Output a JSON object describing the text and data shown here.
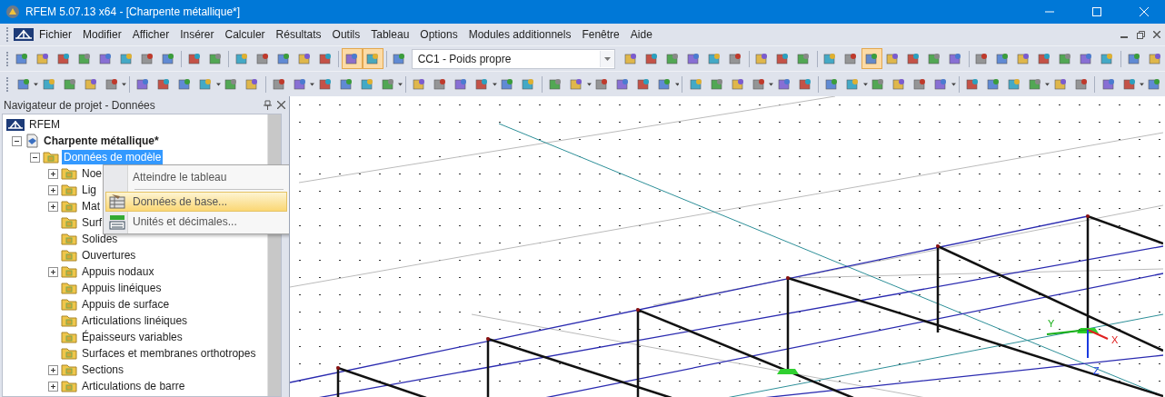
{
  "window": {
    "title": "RFEM 5.07.13 x64 - [Charpente métallique*]"
  },
  "menu": [
    "Fichier",
    "Modifier",
    "Afficher",
    "Insérer",
    "Calculer",
    "Résultats",
    "Outils",
    "Tableau",
    "Options",
    "Modules additionnels",
    "Fenêtre",
    "Aide"
  ],
  "toolbar_1_left": [
    {
      "kind": "button",
      "pressed": false
    },
    {
      "kind": "button",
      "pressed": false
    },
    {
      "kind": "button",
      "pressed": false
    },
    {
      "kind": "button",
      "pressed": false
    },
    {
      "kind": "button",
      "pressed": false
    },
    {
      "kind": "button",
      "pressed": false
    },
    {
      "kind": "button",
      "pressed": false
    },
    {
      "kind": "button",
      "pressed": false
    },
    {
      "kind": "separator"
    },
    {
      "kind": "button",
      "pressed": false
    },
    {
      "kind": "button",
      "pressed": false
    },
    {
      "kind": "separator"
    },
    {
      "kind": "button",
      "pressed": false
    },
    {
      "kind": "button",
      "pressed": false
    },
    {
      "kind": "button",
      "pressed": false
    },
    {
      "kind": "button",
      "pressed": false
    },
    {
      "kind": "button",
      "pressed": false
    },
    {
      "kind": "separator"
    },
    {
      "kind": "button",
      "pressed": true
    },
    {
      "kind": "button",
      "pressed": true
    },
    {
      "kind": "separator"
    },
    {
      "kind": "button",
      "pressed": false
    }
  ],
  "load_case": {
    "value": "CC1 - Poids propre"
  },
  "toolbar_1_right": [
    {
      "kind": "button",
      "pressed": false
    },
    {
      "kind": "button",
      "pressed": false
    },
    {
      "kind": "button",
      "pressed": false
    },
    {
      "kind": "button",
      "pressed": false
    },
    {
      "kind": "button",
      "pressed": false
    },
    {
      "kind": "button",
      "pressed": false
    },
    {
      "kind": "separator"
    },
    {
      "kind": "button",
      "pressed": false
    },
    {
      "kind": "button",
      "pressed": false
    },
    {
      "kind": "button",
      "pressed": false
    },
    {
      "kind": "separator"
    },
    {
      "kind": "button",
      "pressed": false
    },
    {
      "kind": "button",
      "pressed": false
    },
    {
      "kind": "button",
      "pressed": true
    },
    {
      "kind": "button",
      "pressed": false
    },
    {
      "kind": "button",
      "pressed": false
    },
    {
      "kind": "button",
      "pressed": false
    },
    {
      "kind": "button",
      "pressed": false
    },
    {
      "kind": "separator"
    },
    {
      "kind": "button",
      "pressed": false
    },
    {
      "kind": "button",
      "pressed": false
    },
    {
      "kind": "button",
      "pressed": false
    },
    {
      "kind": "button",
      "pressed": false
    },
    {
      "kind": "button",
      "pressed": false
    },
    {
      "kind": "button",
      "pressed": false
    },
    {
      "kind": "button",
      "pressed": false
    },
    {
      "kind": "separator"
    },
    {
      "kind": "button",
      "pressed": false
    },
    {
      "kind": "button",
      "pressed": false
    }
  ],
  "navigator": {
    "title": "Navigateur de projet - Données",
    "tree": [
      {
        "label": "RFEM",
        "kind": "root",
        "selected": false,
        "children": [
          {
            "label": "Charpente métallique*",
            "kind": "project",
            "expanded": true,
            "selected": false,
            "children": [
              {
                "label": "Données de modèle",
                "kind": "node",
                "expanded": true,
                "selected": true,
                "children": [
                  {
                    "label": "Noe",
                    "kind": "node",
                    "expanded": false,
                    "selected": false
                  },
                  {
                    "label": "Lig",
                    "kind": "node",
                    "expanded": false,
                    "selected": false
                  },
                  {
                    "label": "Mat",
                    "kind": "node",
                    "expanded": false,
                    "selected": false
                  },
                  {
                    "label": "Surf",
                    "kind": "leaf",
                    "selected": false
                  },
                  {
                    "label": "Solides",
                    "kind": "leaf",
                    "selected": false
                  },
                  {
                    "label": "Ouvertures",
                    "kind": "leaf",
                    "selected": false
                  },
                  {
                    "label": "Appuis nodaux",
                    "kind": "node",
                    "expanded": false,
                    "selected": false
                  },
                  {
                    "label": "Appuis linéiques",
                    "kind": "leaf",
                    "selected": false
                  },
                  {
                    "label": "Appuis de surface",
                    "kind": "leaf",
                    "selected": false
                  },
                  {
                    "label": "Articulations linéiques",
                    "kind": "leaf",
                    "selected": false
                  },
                  {
                    "label": "Épaisseurs variables",
                    "kind": "leaf",
                    "selected": false
                  },
                  {
                    "label": "Surfaces et membranes orthotropes",
                    "kind": "leaf",
                    "selected": false
                  },
                  {
                    "label": "Sections",
                    "kind": "node",
                    "expanded": false,
                    "selected": false
                  },
                  {
                    "label": "Articulations de barre",
                    "kind": "node",
                    "expanded": false,
                    "selected": false
                  }
                ]
              }
            ]
          }
        ]
      }
    ]
  },
  "context_menu": [
    {
      "label": "Atteindre le tableau",
      "kind": "plain",
      "selected": false
    },
    {
      "kind": "separator"
    },
    {
      "label": "Données de base...",
      "kind": "basic-data",
      "selected": true
    },
    {
      "label": "Unités et décimales...",
      "kind": "units",
      "selected": false
    }
  ],
  "viewport": {
    "axes": [
      {
        "label": "Y",
        "kind": "y"
      },
      {
        "label": "X",
        "kind": "x"
      },
      {
        "label": "Z",
        "kind": "z"
      }
    ]
  }
}
